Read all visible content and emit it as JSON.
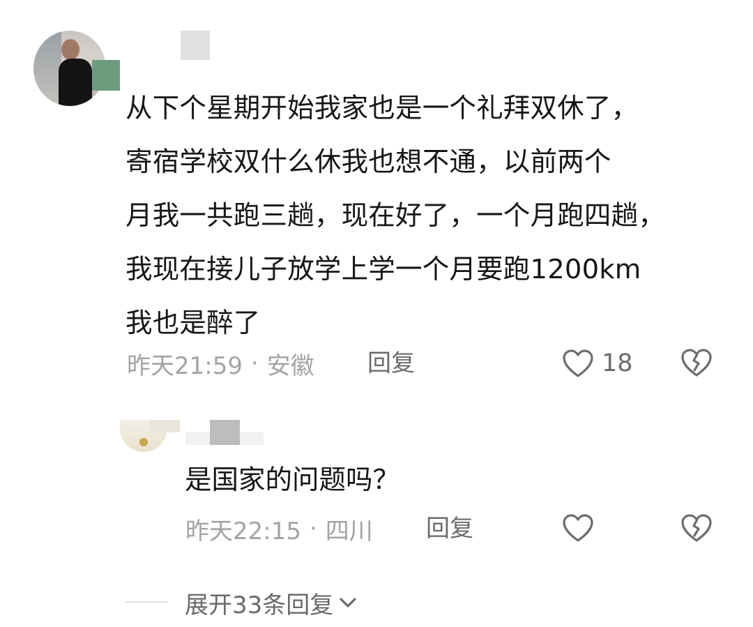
{
  "main_comment": {
    "text_lines": [
      "从下个星期开始我家也是一个礼拜双休了，",
      "寄宿学校双什么休我也想不通，以前两个",
      "月我一共跑三趟，现在好了，一个月跑四趟，",
      "我现在接儿子放学上学一个月要跑1200km",
      "我也是醉了"
    ],
    "time": "昨天21:59",
    "separator": "·",
    "location": "安徽",
    "reply_label": "回复",
    "like_count": "18"
  },
  "sub_reply": {
    "text": "是国家的问题吗？",
    "time": "昨天22:15",
    "separator": "·",
    "location": "四川",
    "reply_label": "回复"
  },
  "expand": {
    "label": "展开33条回复"
  },
  "icons": {
    "like": "heart-outline-icon",
    "dislike": "broken-heart-icon",
    "expand": "chevron-down-icon"
  },
  "colors": {
    "text": "#161616",
    "meta": "#a3a3a3",
    "action": "#6a6a6a"
  }
}
